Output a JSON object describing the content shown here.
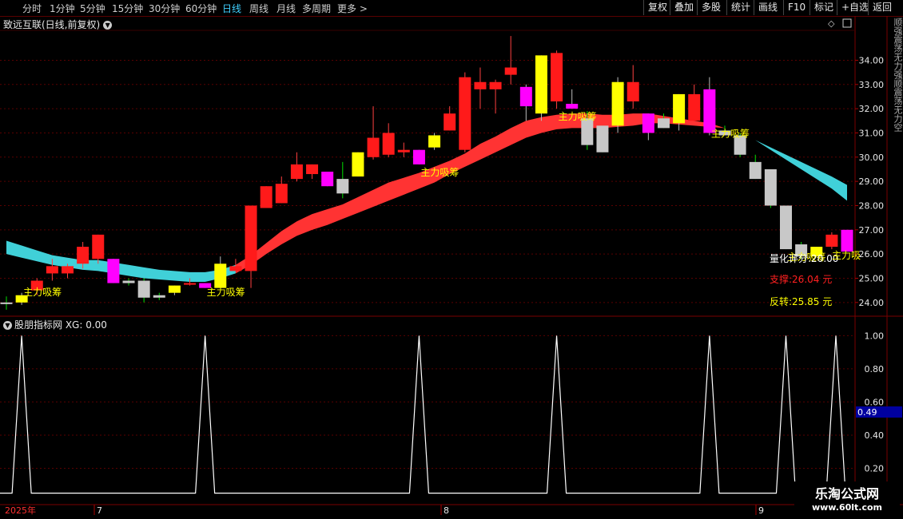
{
  "toolbar": {
    "timeframes": [
      "分时",
      "1分钟",
      "5分钟",
      "15分钟",
      "30分钟",
      "60分钟",
      "日线",
      "周线",
      "月线",
      "多周期",
      "更多 >"
    ],
    "active_timeframe": "日线",
    "right_buttons": [
      "复权",
      "叠加",
      "多股",
      "统计",
      "画线",
      "F10",
      "标记",
      "+自选",
      "返回"
    ]
  },
  "main_title": "致远互联(日线,前复权)",
  "sub_title": "股朋指标网 XG: 0.00",
  "annotations": {
    "label": "主力吸筹",
    "score": "量化评分:20.00",
    "support": "支撑:26.04 元",
    "reversal": "反转:25.85 元",
    "partial_label": "主力吸"
  },
  "side_text": "顺强震荡无力强顺震荡无力空",
  "x_axis": {
    "year_label": "2025年",
    "months": [
      "7",
      "8",
      "9"
    ]
  },
  "value_tag": "0.49",
  "watermark": {
    "logo": "乐淘公式网",
    "url": "www.60lt.com"
  },
  "colors": {
    "up": "#ff1a1a",
    "down": "#c8c8c8",
    "yellow": "#ffff00",
    "magenta": "#ff00ff",
    "band_red": "#ff3333",
    "band_cyan": "#40d0d8"
  },
  "chart_data": [
    {
      "type": "candlestick",
      "title": "致远互联(日线,前复权)",
      "y_ticks": [
        24,
        25,
        26,
        27,
        28,
        29,
        30,
        31,
        32,
        33,
        34
      ],
      "ylim": [
        23.5,
        35.3
      ],
      "series_ohlc": [
        [
          24.0,
          24.25,
          23.7,
          24.0,
          "down"
        ],
        [
          24.0,
          24.4,
          23.9,
          24.3,
          "yellow"
        ],
        [
          24.5,
          25.0,
          24.3,
          24.9,
          "up"
        ],
        [
          25.2,
          25.8,
          24.9,
          25.5,
          "up"
        ],
        [
          25.2,
          25.6,
          25.0,
          25.5,
          "up"
        ],
        [
          25.6,
          26.5,
          25.4,
          26.3,
          "up"
        ],
        [
          25.8,
          26.8,
          25.6,
          26.8,
          "up"
        ],
        [
          25.8,
          25.8,
          24.8,
          24.8,
          "magenta"
        ],
        [
          24.9,
          25.0,
          24.7,
          24.8,
          "down"
        ],
        [
          24.9,
          25.0,
          24.0,
          24.2,
          "down"
        ],
        [
          24.3,
          24.4,
          24.1,
          24.2,
          "down"
        ],
        [
          24.4,
          24.7,
          24.3,
          24.7,
          "yellow"
        ],
        [
          24.8,
          25.0,
          24.7,
          24.8,
          "up"
        ],
        [
          24.8,
          24.8,
          24.6,
          24.6,
          "magenta"
        ],
        [
          24.6,
          25.9,
          24.6,
          25.6,
          "yellow"
        ],
        [
          25.5,
          25.8,
          25.3,
          25.3,
          "up"
        ],
        [
          25.3,
          28.0,
          24.6,
          28.0,
          "up"
        ],
        [
          27.9,
          28.8,
          27.9,
          28.8,
          "up"
        ],
        [
          28.1,
          29.2,
          28.1,
          28.9,
          "up"
        ],
        [
          29.1,
          30.2,
          29.0,
          29.7,
          "up"
        ],
        [
          29.3,
          29.7,
          29.1,
          29.7,
          "up"
        ],
        [
          29.4,
          29.4,
          28.8,
          28.8,
          "magenta"
        ],
        [
          28.5,
          29.8,
          28.3,
          29.1,
          "down"
        ],
        [
          29.2,
          30.2,
          29.2,
          30.2,
          "yellow"
        ],
        [
          30.0,
          32.1,
          29.9,
          30.8,
          "up"
        ],
        [
          30.1,
          31.4,
          30.0,
          31.0,
          "up"
        ],
        [
          30.2,
          30.6,
          30.0,
          30.3,
          "up"
        ],
        [
          30.3,
          30.3,
          29.7,
          29.7,
          "magenta"
        ],
        [
          30.4,
          31.0,
          30.3,
          30.9,
          "yellow"
        ],
        [
          31.1,
          32.1,
          31.1,
          31.8,
          "up"
        ],
        [
          30.3,
          33.5,
          30.2,
          33.3,
          "up"
        ],
        [
          32.8,
          33.7,
          32.0,
          33.1,
          "up"
        ],
        [
          32.8,
          33.2,
          31.8,
          33.1,
          "up"
        ],
        [
          33.4,
          35.0,
          33.0,
          33.7,
          "up"
        ],
        [
          32.1,
          33.0,
          31.5,
          32.9,
          "magenta"
        ],
        [
          31.8,
          34.2,
          31.5,
          34.2,
          "yellow"
        ],
        [
          32.3,
          34.4,
          32.0,
          34.3,
          "up"
        ],
        [
          32.2,
          32.8,
          32.0,
          32.0,
          "magenta"
        ],
        [
          31.6,
          31.9,
          30.3,
          30.5,
          "down"
        ],
        [
          31.3,
          31.3,
          30.2,
          30.2,
          "down"
        ],
        [
          31.3,
          33.3,
          31.0,
          33.1,
          "yellow"
        ],
        [
          32.3,
          33.8,
          32.0,
          33.1,
          "up"
        ],
        [
          31.8,
          31.8,
          30.7,
          31.0,
          "magenta"
        ],
        [
          31.6,
          31.8,
          31.2,
          31.2,
          "down"
        ],
        [
          31.4,
          32.6,
          31.1,
          32.6,
          "yellow"
        ],
        [
          31.5,
          33.0,
          31.5,
          32.6,
          "up"
        ],
        [
          31.0,
          33.3,
          30.9,
          32.8,
          "magenta"
        ],
        [
          31.1,
          31.3,
          31.0,
          30.9,
          "down"
        ],
        [
          30.9,
          31.0,
          30.0,
          30.1,
          "down"
        ],
        [
          29.8,
          30.1,
          29.1,
          29.1,
          "down"
        ],
        [
          29.5,
          29.5,
          27.9,
          28.0,
          "down"
        ],
        [
          28.0,
          28.0,
          26.2,
          26.2,
          "down"
        ],
        [
          26.4,
          26.5,
          25.8,
          25.9,
          "down"
        ],
        [
          25.9,
          26.3,
          25.9,
          26.3,
          "yellow"
        ],
        [
          26.3,
          26.9,
          26.2,
          26.8,
          "up"
        ],
        [
          26.1,
          27.0,
          26.1,
          27.0,
          "magenta"
        ]
      ],
      "band_upper": [
        26.55,
        26.35,
        26.15,
        25.95,
        25.85,
        25.75,
        25.75,
        25.65,
        25.55,
        25.45,
        25.35,
        25.3,
        25.25,
        25.25,
        25.35,
        25.55,
        25.95,
        26.45,
        26.95,
        27.35,
        27.65,
        27.85,
        28.05,
        28.35,
        28.65,
        28.95,
        29.15,
        29.35,
        29.6,
        29.85,
        30.15,
        30.55,
        30.85,
        31.2,
        31.5,
        31.65,
        31.75,
        31.8,
        31.8,
        31.75,
        31.75,
        31.8,
        31.8,
        31.7,
        31.6,
        31.5,
        31.4,
        31.2,
        31.0,
        30.7,
        30.4,
        30.1,
        29.8,
        29.5,
        29.2,
        28.85
      ],
      "band_lower": [
        26.0,
        25.85,
        25.7,
        25.55,
        25.45,
        25.35,
        25.3,
        25.2,
        25.1,
        25.0,
        24.95,
        24.9,
        24.85,
        24.85,
        25.0,
        25.2,
        25.55,
        26.0,
        26.4,
        26.75,
        27.0,
        27.2,
        27.45,
        27.7,
        27.95,
        28.2,
        28.45,
        28.7,
        28.95,
        29.3,
        29.6,
        29.9,
        30.2,
        30.5,
        30.8,
        31.0,
        31.15,
        31.2,
        31.2,
        31.2,
        31.25,
        31.3,
        31.4,
        31.4,
        31.35,
        31.3,
        31.25,
        31.2,
        31.0,
        30.7,
        30.3,
        29.9,
        29.5,
        29.1,
        28.7,
        28.2
      ],
      "signal_label": "主力吸筹",
      "signal_candles": [
        1,
        13,
        27,
        36,
        46,
        51
      ]
    },
    {
      "type": "line",
      "title": "股朋指标网 XG: 0.00",
      "y_ticks": [
        0.2,
        0.4,
        0.6,
        0.8,
        1.0
      ],
      "ylim": [
        0,
        1.05
      ],
      "peak_candles": [
        1,
        13,
        27,
        36,
        46,
        51,
        55
      ],
      "values_note": "spikes to 1.00 at signal days, otherwise 0"
    }
  ]
}
